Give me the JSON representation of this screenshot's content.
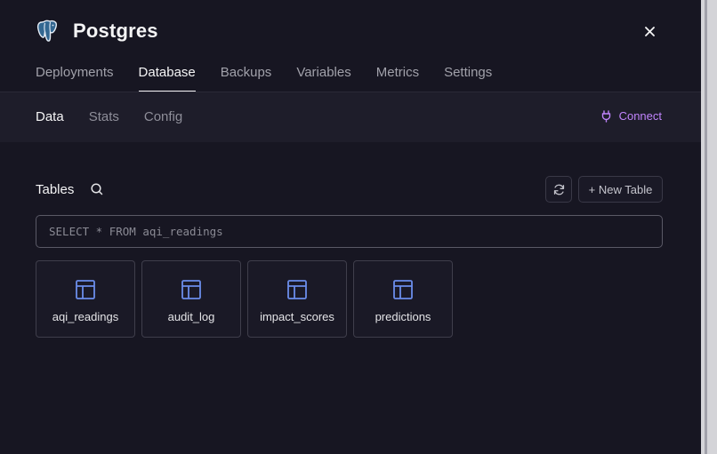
{
  "app": {
    "title": "Postgres",
    "logo_icon": "postgres-elephant-icon",
    "close_icon": "close-icon"
  },
  "tabs": [
    {
      "label": "Deployments",
      "active": false
    },
    {
      "label": "Database",
      "active": true
    },
    {
      "label": "Backups",
      "active": false
    },
    {
      "label": "Variables",
      "active": false
    },
    {
      "label": "Metrics",
      "active": false
    },
    {
      "label": "Settings",
      "active": false
    }
  ],
  "subtabs": [
    {
      "label": "Data",
      "active": true
    },
    {
      "label": "Stats",
      "active": false
    },
    {
      "label": "Config",
      "active": false
    }
  ],
  "connect": {
    "label": "Connect",
    "icon": "plug-icon"
  },
  "tables_section": {
    "label": "Tables",
    "search_icon": "search-icon",
    "refresh_icon": "refresh-icon",
    "new_table_label": "+ New Table"
  },
  "query": {
    "placeholder": "SELECT * FROM aqi_readings",
    "value": ""
  },
  "tables": [
    {
      "name": "aqi_readings",
      "icon": "table-icon"
    },
    {
      "name": "audit_log",
      "icon": "table-icon"
    },
    {
      "name": "impact_scores",
      "icon": "table-icon"
    },
    {
      "name": "predictions",
      "icon": "table-icon"
    }
  ],
  "colors": {
    "background": "#171622",
    "subbar": "#1e1d2a",
    "accent_purple": "#c084fc",
    "table_icon_blue": "#6b8dea",
    "logo_blue": "#336791"
  }
}
